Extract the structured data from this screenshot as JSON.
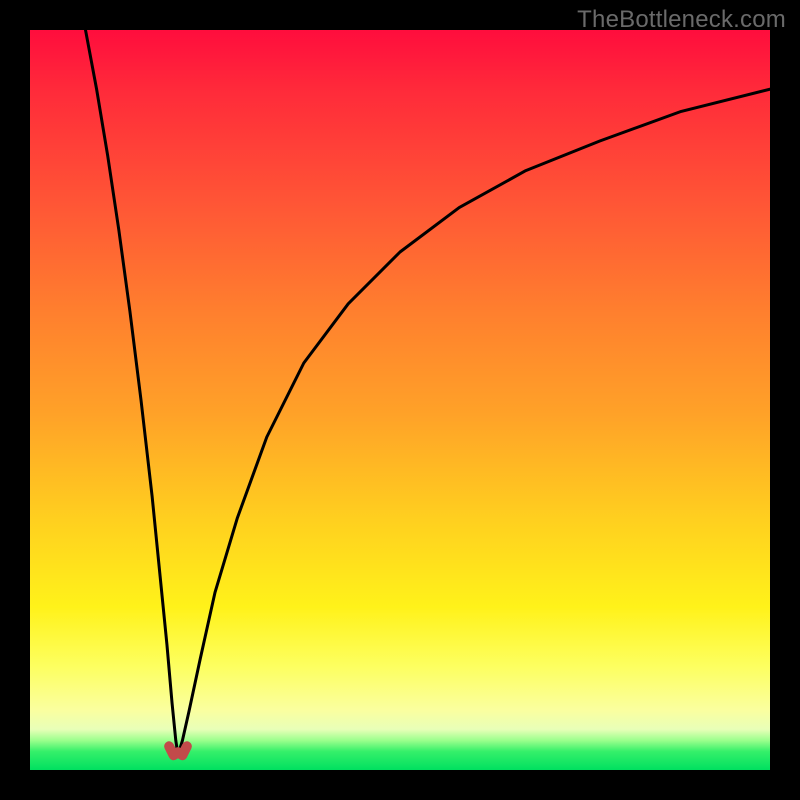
{
  "watermark": {
    "text": "TheBottleneck.com"
  },
  "chart_data": {
    "type": "line",
    "title": "",
    "xlabel": "",
    "ylabel": "",
    "x_range": [
      0,
      100
    ],
    "y_range": [
      0,
      100
    ],
    "grid": false,
    "legend": false,
    "gradient_stops": [
      {
        "pos": 0,
        "color": "#ff0d3d"
      },
      {
        "pos": 8,
        "color": "#ff2a3a"
      },
      {
        "pos": 25,
        "color": "#ff5a35"
      },
      {
        "pos": 38,
        "color": "#ff7f2e"
      },
      {
        "pos": 52,
        "color": "#ffa228"
      },
      {
        "pos": 66,
        "color": "#ffcf1f"
      },
      {
        "pos": 78,
        "color": "#fff21a"
      },
      {
        "pos": 86,
        "color": "#fdff60"
      },
      {
        "pos": 92,
        "color": "#faffa0"
      },
      {
        "pos": 94.5,
        "color": "#e8ffb8"
      },
      {
        "pos": 96,
        "color": "#9bff8c"
      },
      {
        "pos": 97.5,
        "color": "#35f06a"
      },
      {
        "pos": 100,
        "color": "#00e060"
      }
    ],
    "minimum_x": 20,
    "series": [
      {
        "name": "left-branch",
        "x": [
          7.5,
          9,
          10.5,
          12,
          13.5,
          15,
          16.5,
          17.5,
          18.5,
          19.2,
          19.7,
          20
        ],
        "y": [
          100,
          92,
          83,
          73,
          62,
          50,
          37,
          27,
          17,
          9,
          4,
          2
        ],
        "stroke": "#000000",
        "stroke_width": 3
      },
      {
        "name": "right-branch",
        "x": [
          20,
          20.6,
          21.5,
          23,
          25,
          28,
          32,
          37,
          43,
          50,
          58,
          67,
          77,
          88,
          100
        ],
        "y": [
          2,
          4,
          8,
          15,
          24,
          34,
          45,
          55,
          63,
          70,
          76,
          81,
          85,
          89,
          92
        ],
        "stroke": "#000000",
        "stroke_width": 3
      },
      {
        "name": "minimum-notch",
        "x": [
          18.8,
          19.4,
          20,
          20.6,
          21.2
        ],
        "y": [
          3.2,
          2.0,
          2.4,
          2.0,
          3.2
        ],
        "stroke": "#c24a4a",
        "stroke_width": 10
      }
    ]
  }
}
